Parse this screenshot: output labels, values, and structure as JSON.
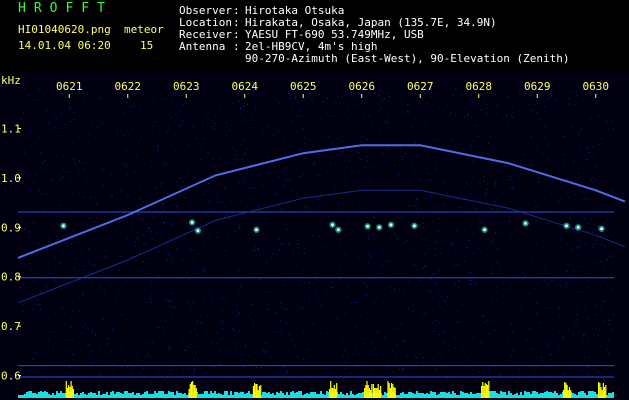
{
  "header": {
    "brand": "HROFFT",
    "filename": "HI01040620.png",
    "datetime": "14.01.04 06:20",
    "meteor_label": "meteor",
    "meteor_count": "15",
    "observer_label": "Observer",
    "observer": "Hirotaka Otsuka",
    "location_label": "Location",
    "location": "Hirakata, Osaka, Japan (135.7E, 34.9N)",
    "receiver_label": "Receiver",
    "receiver": "YAESU FT-690 53.749MHz, USB",
    "antenna_label": "Antenna",
    "antenna_line1": "2el-HB9CV, 4m's high",
    "antenna_line2": "90-270-Azimuth (East-West), 90-Elevation (Zenith)"
  },
  "colors": {
    "background": "#000010",
    "noise": "#1a2aa0",
    "signal": "#5a78ff",
    "meteor_core": "#ffffff",
    "meteor_halo": "#22ffcc",
    "bar_base": "#18e0e0",
    "bar_peak": "#ffff00",
    "label": "#ffff66"
  },
  "chart_data": {
    "type": "heatmap",
    "ylabel": "kHz",
    "x_ticks": [
      "0621",
      "0622",
      "0623",
      "0624",
      "0625",
      "0626",
      "0627",
      "0628",
      "0629",
      "0630"
    ],
    "y_ticks": [
      1.1,
      1.0,
      0.9,
      0.8,
      0.7,
      0.6
    ],
    "ylim": [
      0.58,
      1.18
    ],
    "xlim_minutes": [
      0,
      10
    ],
    "carrier_trace": [
      {
        "t": 0.0,
        "f": 0.838
      },
      {
        "t": 1.5,
        "f": 0.925
      },
      {
        "t": 3.0,
        "f": 1.005
      },
      {
        "t": 4.5,
        "f": 1.05
      },
      {
        "t": 5.5,
        "f": 1.066
      },
      {
        "t": 6.5,
        "f": 1.066
      },
      {
        "t": 8.0,
        "f": 1.03
      },
      {
        "t": 9.5,
        "f": 0.975
      },
      {
        "t": 10.0,
        "f": 0.952
      }
    ],
    "horizontal_lines_khz": [
      0.931,
      0.798,
      0.62,
      0.597
    ],
    "meteor_echoes": [
      {
        "t": 0.4,
        "f": 0.903
      },
      {
        "t": 2.6,
        "f": 0.91
      },
      {
        "t": 2.7,
        "f": 0.893
      },
      {
        "t": 3.7,
        "f": 0.895
      },
      {
        "t": 5.0,
        "f": 0.905
      },
      {
        "t": 5.1,
        "f": 0.895
      },
      {
        "t": 5.6,
        "f": 0.902
      },
      {
        "t": 5.8,
        "f": 0.9
      },
      {
        "t": 6.0,
        "f": 0.905
      },
      {
        "t": 6.4,
        "f": 0.903
      },
      {
        "t": 7.6,
        "f": 0.895
      },
      {
        "t": 8.3,
        "f": 0.908
      },
      {
        "t": 9.0,
        "f": 0.903
      },
      {
        "t": 9.2,
        "f": 0.9
      },
      {
        "t": 9.6,
        "f": 0.897
      }
    ],
    "activity_peaks_minutes": [
      0.5,
      2.6,
      3.7,
      5.0,
      5.6,
      5.75,
      6.0,
      7.6,
      9.0,
      9.6
    ]
  }
}
